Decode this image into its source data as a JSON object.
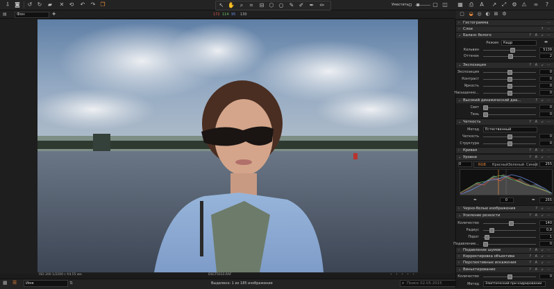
{
  "toolbar": {
    "preview_label": "Уместить",
    "rgb": {
      "r": "172",
      "g": "114",
      "b": "95",
      "a": "130"
    }
  },
  "viewer": {
    "preset_value": "Фон",
    "caption_left": "ISO 200 1/2200 с f/4.55 мм",
    "caption_center": "DSCF5033.RAF"
  },
  "bottom": {
    "sort_value": "Имя",
    "status": "Выделено: 1 из 185 изображения",
    "search_placeholder": "Поиск 02.05.2015"
  },
  "panel": {
    "sections": {
      "histogram": "Гистограмма",
      "layers": "Слои",
      "white_balance": "Баланс белого",
      "exposure": "Экспозиция",
      "hdr": "Высокий динамический диа...",
      "clarity": "Четкость",
      "curve": "Кривая",
      "levels": "Уровни",
      "bw": "Черно-белые изображения",
      "sharpening": "Усиление резкости",
      "noise": "Подавление шумов",
      "lens": "Корректировка объектива",
      "keystone": "Перспективные искажения",
      "vignetting": "Виньетирование"
    },
    "wb": {
      "mode_label": "Режим",
      "mode_value": "Кадр",
      "kelvin_label": "Кельвин",
      "kelvin_value": "5139",
      "tint_label": "Оттенок",
      "tint_value": "2"
    },
    "exposure": {
      "exp_label": "Экспозиция",
      "exp_value": "0",
      "contrast_label": "Контраст",
      "contrast_value": "0",
      "brightness_label": "Яркость",
      "brightness_value": "0",
      "saturation_label": "Насыщенно...",
      "saturation_value": "0"
    },
    "hdr": {
      "light_label": "Свет",
      "light_value": "0",
      "shadow_label": "Тень",
      "shadow_value": "0"
    },
    "clarity": {
      "method_label": "Метод",
      "method_value": "Естественный",
      "clarity_label": "Четкость",
      "clarity_value": "0",
      "structure_label": "Структура",
      "structure_value": "0"
    },
    "levels": {
      "low_value": "0",
      "high_value": "255",
      "channels": [
        "RGB",
        "Красный",
        "Зеленый",
        "Синий"
      ],
      "mid_value": "0",
      "right_value": "255"
    },
    "sharpening": {
      "amount_label": "Количество",
      "amount_value": "140",
      "radius_label": "Радиус",
      "radius_value": "0,8",
      "threshold_label": "Порог",
      "threshold_value": "1",
      "halo_label": "Подавление...",
      "halo_value": "0"
    },
    "vignetting": {
      "amount_label": "Количество",
      "amount_value": "0",
      "method_label": "Метод",
      "method_value": "Элиптический при кадрировании"
    }
  },
  "colors": {
    "accent": "#e8883a",
    "red_channel": "#e05a4a",
    "green_channel": "#6ac46a",
    "blue_channel": "#6a8ae0"
  }
}
